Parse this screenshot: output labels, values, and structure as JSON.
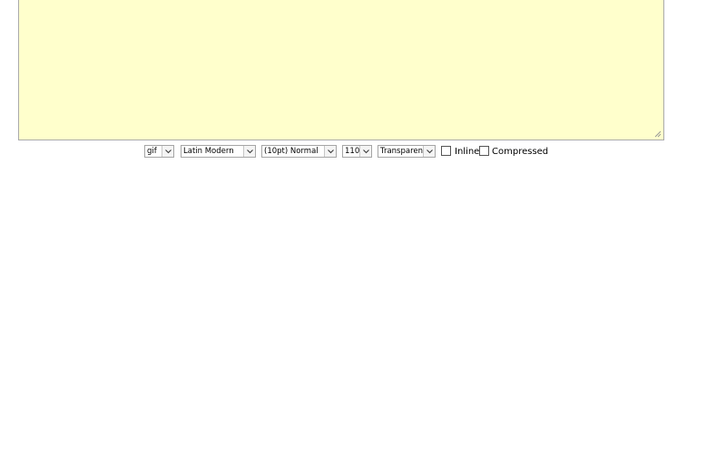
{
  "editor": {
    "content": "",
    "background": "#ffffcc"
  },
  "toolbar": {
    "format_select": {
      "value": "gif"
    },
    "font_select": {
      "value": "Latin Modern"
    },
    "size_select": {
      "value": "(10pt) Normal"
    },
    "dpi_select": {
      "value": "110"
    },
    "background_select": {
      "value": "Transparent"
    },
    "inline_checkbox": {
      "label": "Inline",
      "checked": false
    },
    "compressed_checkbox": {
      "label": "Compressed",
      "checked": false
    }
  }
}
